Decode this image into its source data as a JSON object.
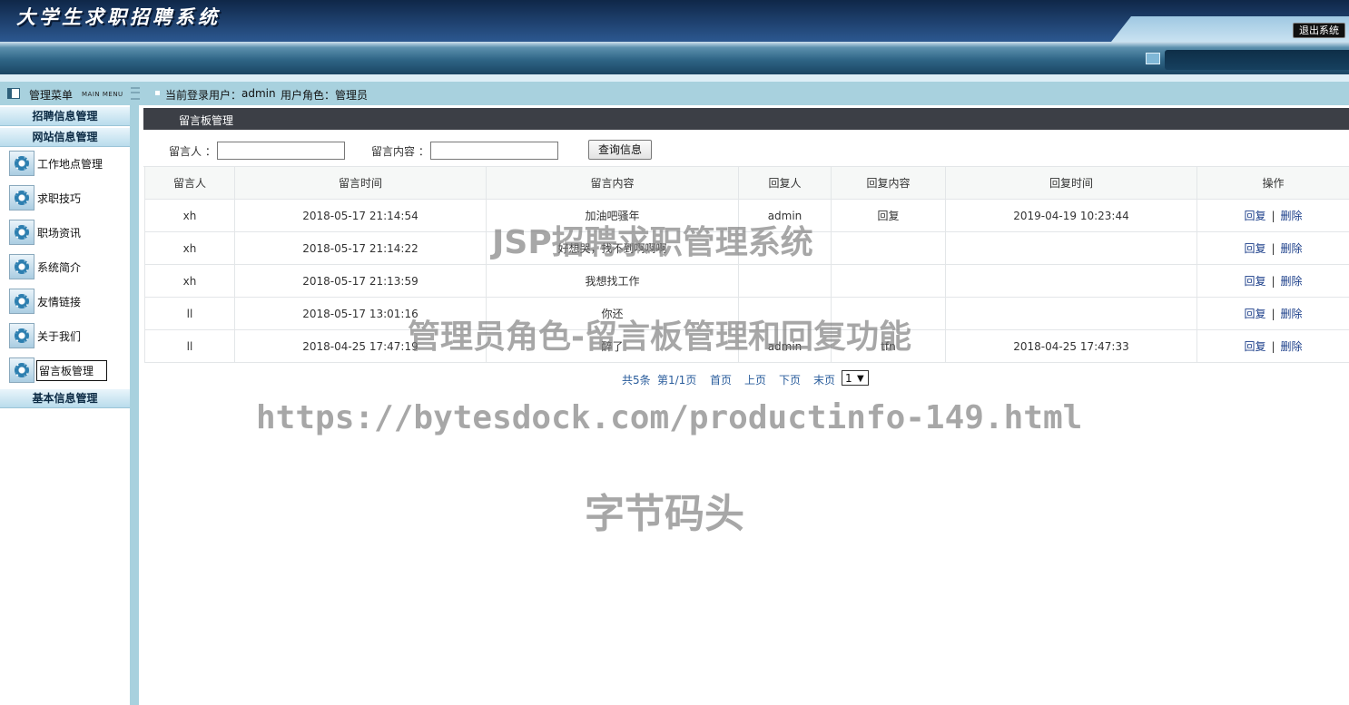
{
  "header": {
    "title": "大学生求职招聘系统",
    "logout_label": "退出系统"
  },
  "status": {
    "menu_title": "管理菜单",
    "menu_subtitle": "MAIN MENU",
    "login_label": "当前登录用户：",
    "login_user": "admin",
    "role_label": "用户角色：",
    "role_value": "管理员"
  },
  "sidebar": {
    "sections": [
      {
        "label": "招聘信息管理"
      },
      {
        "label": "网站信息管理"
      },
      {
        "label": "基本信息管理"
      }
    ],
    "items": [
      {
        "label": "工作地点管理",
        "icon": "gear-icon"
      },
      {
        "label": "求职技巧",
        "icon": "gear-icon"
      },
      {
        "label": "职场资讯",
        "icon": "gear-icon"
      },
      {
        "label": "系统简介",
        "icon": "gear-icon"
      },
      {
        "label": "友情链接",
        "icon": "gear-icon"
      },
      {
        "label": "关于我们",
        "icon": "gear-icon"
      },
      {
        "label": "留言板管理",
        "icon": "gear-icon",
        "active": true
      }
    ]
  },
  "panel": {
    "title": "留言板管理"
  },
  "search": {
    "label_person": "留言人 ：",
    "label_content": "留言内容 ：",
    "person_value": "",
    "content_value": "",
    "button_label": "查询信息"
  },
  "table": {
    "columns": [
      "留言人",
      "留言时间",
      "留言内容",
      "回复人",
      "回复内容",
      "回复时间",
      "操作"
    ],
    "rows": [
      [
        "xh",
        "2018-05-17 21:14:54",
        "加油吧骚年",
        "admin",
        "回复",
        "2019-04-19 10:23:44"
      ],
      [
        "xh",
        "2018-05-17 21:14:22",
        "好想哭，找不到啊啊啊",
        "",
        "",
        ""
      ],
      [
        "xh",
        "2018-05-17 21:13:59",
        "我想找工作",
        "",
        "",
        ""
      ],
      [
        "ll",
        "2018-05-17 13:01:16",
        "你还",
        "",
        "",
        ""
      ],
      [
        "ll",
        "2018-04-25 17:47:19",
        "醉了",
        "admin",
        "tfn",
        "2018-04-25 17:47:33"
      ]
    ],
    "action_reply": "回复",
    "action_delete": "删除",
    "action_sep": "|"
  },
  "pager": {
    "total": "共5条",
    "page": "第1/1页",
    "first": "首页",
    "prev": "上页",
    "next": "下页",
    "last": "末页",
    "selected": "1"
  },
  "watermarks": {
    "line1": "JSP招聘求职管理系统",
    "line2": "管理员角色-留言板管理和回复功能",
    "line3": "https://bytesdock.com/productinfo-149.html",
    "line4": "字节码头"
  }
}
